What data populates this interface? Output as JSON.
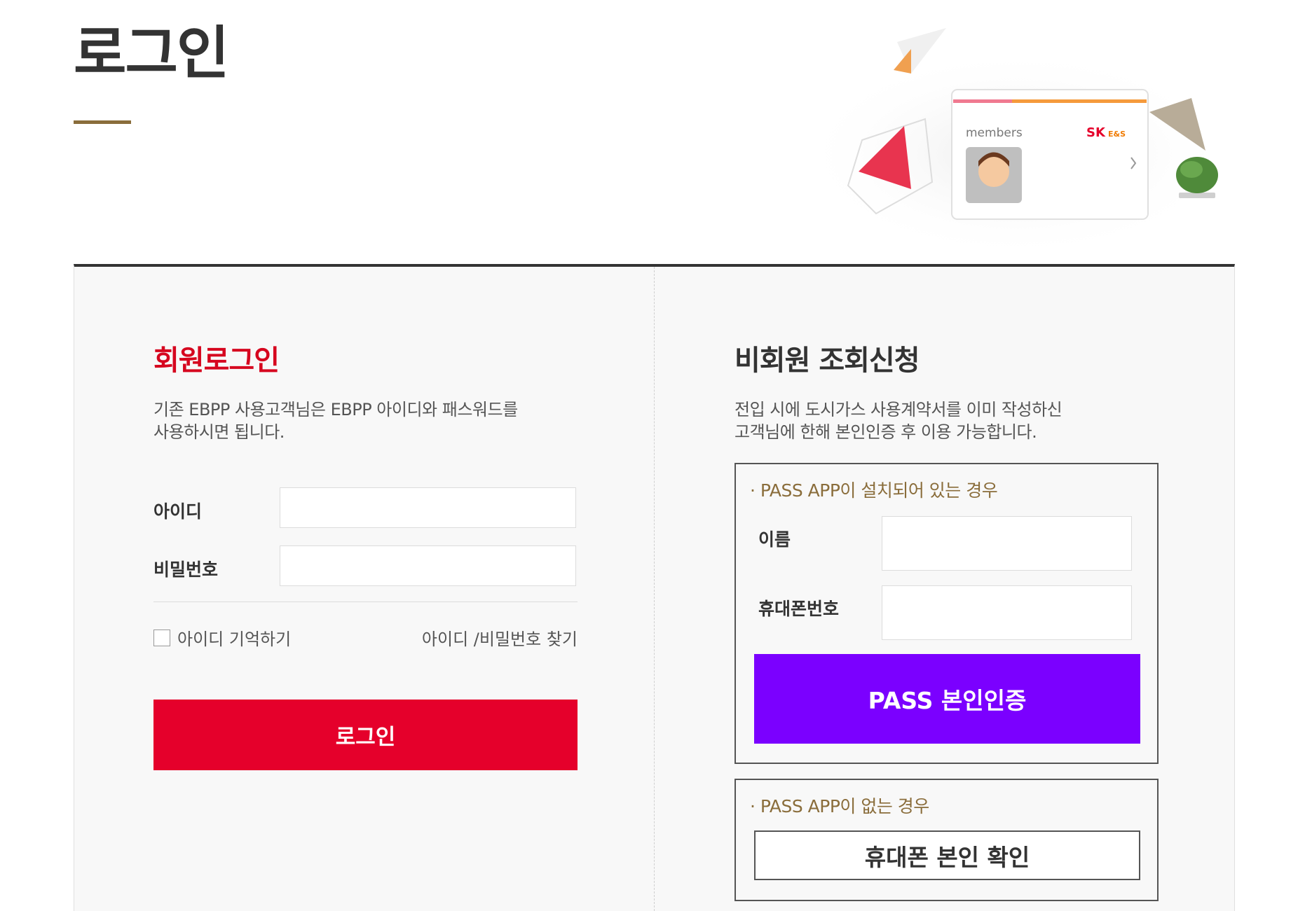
{
  "page": {
    "title": "로그인"
  },
  "hero": {
    "card_label": "members",
    "brand": "SK",
    "brand_sub": "E&S"
  },
  "member_login": {
    "title": "회원로그인",
    "description_line1": "기존 EBPP 사용고객님은 EBPP 아이디와 패스워드를",
    "description_line2": "사용하시면 됩니다.",
    "id_label": "아이디",
    "password_label": "비밀번호",
    "id_value": "",
    "password_value": "",
    "remember_label": "아이디 기억하기",
    "find_link": "아이디 /비밀번호 찾기",
    "login_button": "로그인"
  },
  "guest": {
    "title": "비회원 조회신청",
    "description_line1": "전입 시에 도시가스 사용계약서를 이미 작성하신",
    "description_line2": "고객님에 한해 본인인증 후 이용 가능합니다.",
    "pass_section_title": "· PASS APP이 설치되어 있는 경우",
    "name_label": "이름",
    "phone_label": "휴대폰번호",
    "name_value": "",
    "phone_value": "",
    "pass_button": "PASS 본인인증",
    "no_pass_section_title": "· PASS APP이 없는 경우",
    "phone_verify_button": "휴대폰 본인 확인"
  },
  "colors": {
    "accent_red": "#e5002b",
    "title_red": "#d6061f",
    "pass_purple": "#7b00ff",
    "gold": "#8a6d3b"
  }
}
